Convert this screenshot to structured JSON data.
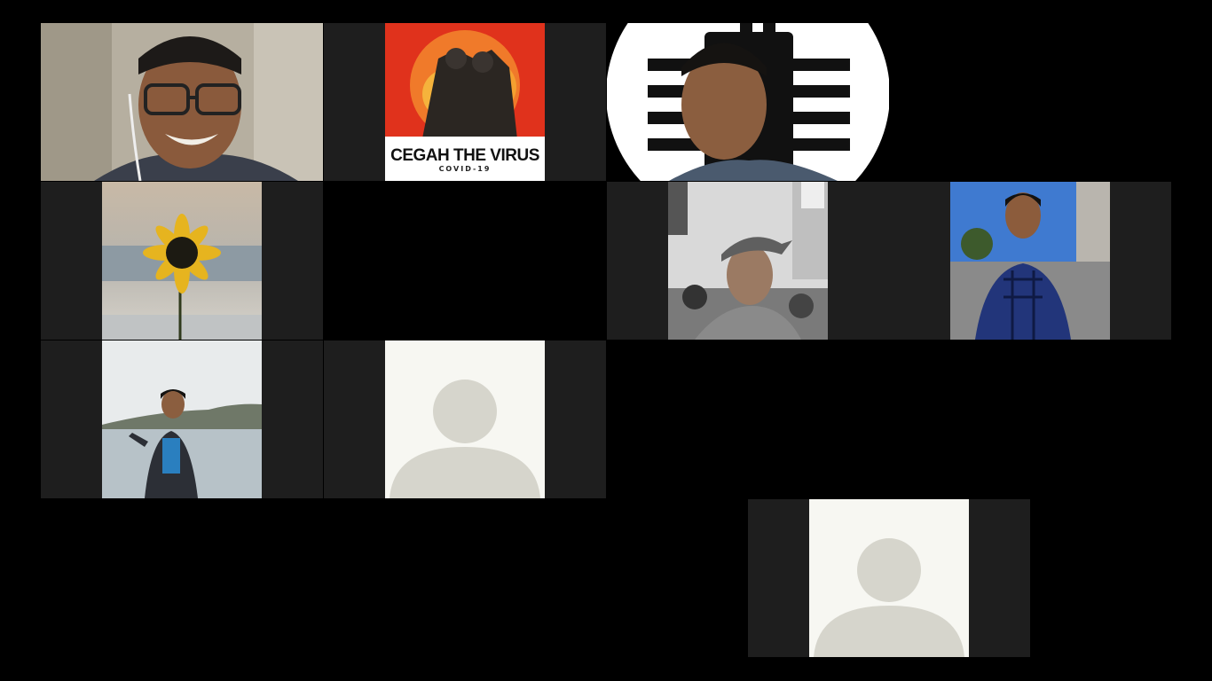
{
  "meeting": {
    "view": "gallery",
    "participants": [
      {
        "id": "p1",
        "video": "on",
        "content": "webcam-smiling-man-glasses"
      },
      {
        "id": "p2",
        "video": "off",
        "content": "profile-picture-poster"
      },
      {
        "id": "p3",
        "video": "on",
        "content": "webcam-man-with-chip-logo"
      },
      {
        "id": "p4",
        "video": "off",
        "content": "profile-picture-sunflower"
      },
      {
        "id": "p5",
        "video": "off",
        "content": "empty-tile"
      },
      {
        "id": "p6",
        "video": "off",
        "content": "profile-picture-man-cap"
      },
      {
        "id": "p7",
        "video": "off",
        "content": "profile-picture-man-plaid-shirt"
      },
      {
        "id": "p8",
        "video": "off",
        "content": "profile-picture-man-lakeside"
      },
      {
        "id": "p9",
        "video": "off",
        "content": "default-avatar"
      },
      {
        "id": "p10",
        "video": "off",
        "content": "default-avatar"
      }
    ],
    "poster": {
      "title": "CEGAH THE VIRUS",
      "subtitle": "COVID-19"
    },
    "icons": {
      "default_avatar": "person-silhouette-icon",
      "chip_logo": "microchip-icon"
    },
    "colors": {
      "background": "#000000",
      "tile": "#1e1e1e",
      "avatar_bg": "#f7f7f2",
      "avatar_fg": "#d6d5cc",
      "poster_red": "#e0321c"
    }
  }
}
